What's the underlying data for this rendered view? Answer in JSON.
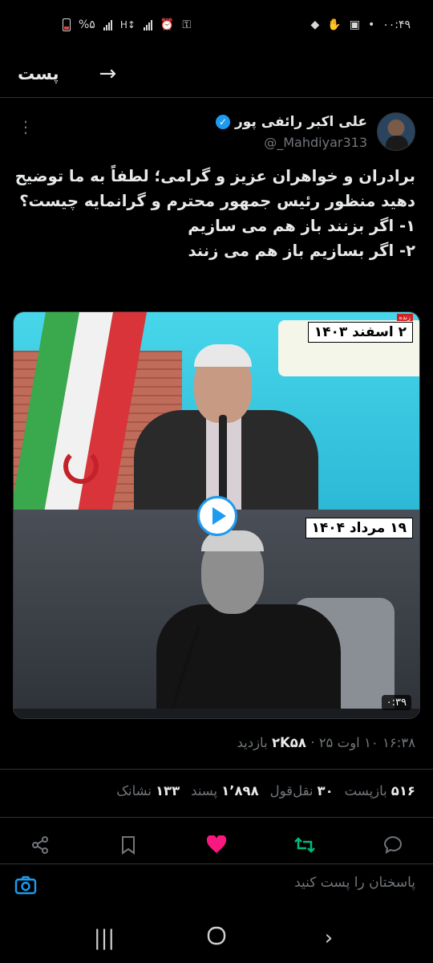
{
  "status_bar": {
    "time": "۰۰:۴۹",
    "battery_percent": "%۵",
    "battery_level": 0.05
  },
  "header": {
    "title": "پست"
  },
  "author": {
    "name": "علی اکبر رائفی پور",
    "handle": "@_Mahdiyar313",
    "verified": true
  },
  "tweet": {
    "lines": [
      "برادران و خواهران عزیز و گرامی؛ لطفاً به ما توضیح",
      "دهید منظور رئیس جمهور محترم و گرانمایه چیست؟",
      "۱- اگر بزنند باز هم می سازیم",
      "۲- اگر بسازیم باز هم  می زنند"
    ]
  },
  "media": {
    "top_date": "۲ اسفند ۱۴۰۳",
    "live_tag": "زنده",
    "bottom_date": "۱۹ مرداد ۱۴۰۴",
    "duration": "۰:۳۹"
  },
  "meta": {
    "time_date": "۱۶:۳۸ ۱۰ اوت ۲۵",
    "sep": "·",
    "views_count": "۲K۵۸",
    "views_label": "بازدید"
  },
  "stats": {
    "reposts_count": "۵۱۶",
    "reposts_label": "بازپست",
    "quotes_count": "۳۰",
    "quotes_label": "نقل‌قول",
    "likes_count": "۱٬۸۹۸",
    "likes_label": "پسند",
    "bookmarks_count": "۱۳۳",
    "bookmarks_label": "نشانک"
  },
  "reply": {
    "placeholder": "پاسختان را پست کنید"
  },
  "colors": {
    "accent": "#1d9bf0",
    "like": "#f91880",
    "repost": "#00ba7c",
    "muted": "#71767b"
  }
}
